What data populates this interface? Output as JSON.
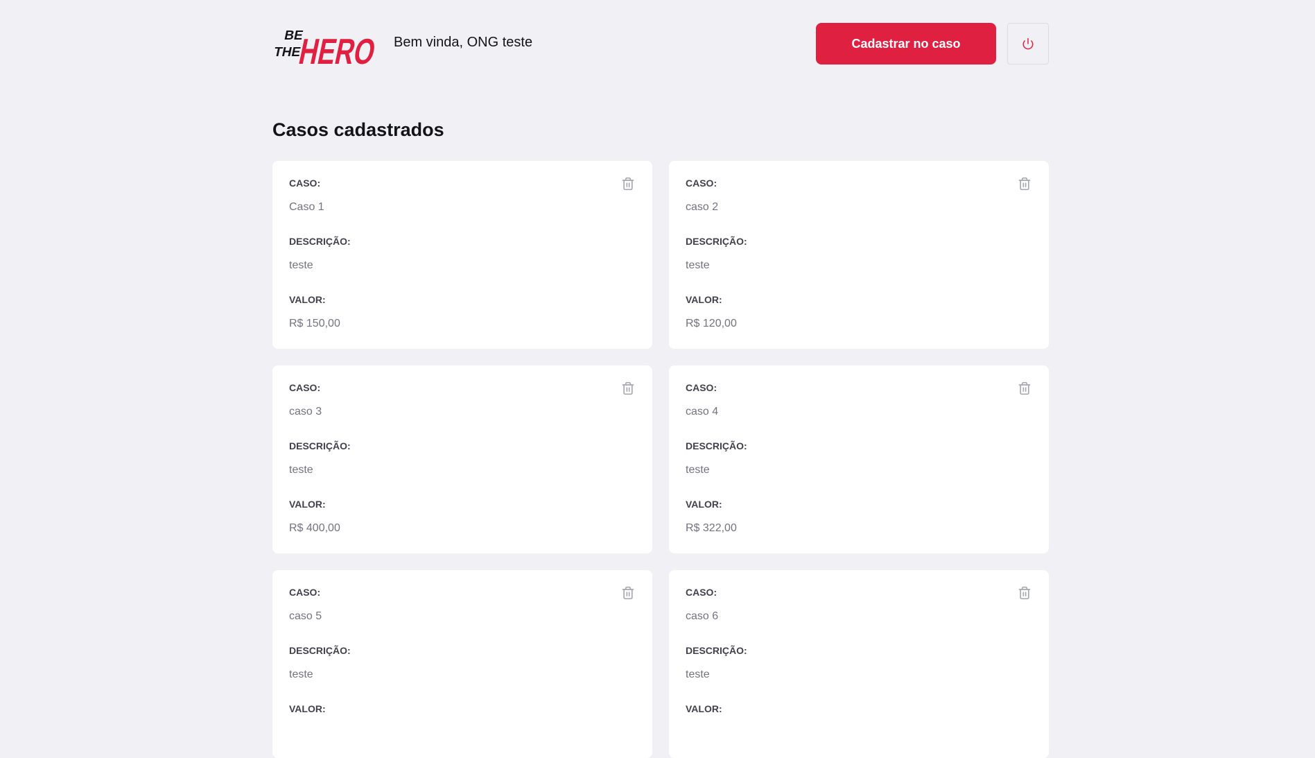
{
  "header": {
    "logo": {
      "top": "BE",
      "middle": "THE",
      "main": "HERO"
    },
    "greeting": "Bem vinda, ONG teste",
    "register_button": "Cadastrar no caso",
    "power_icon": "power-icon"
  },
  "main": {
    "title": "Casos cadastrados",
    "field_labels": {
      "case": "CASO:",
      "description": "DESCRIÇÃO:",
      "value": "VALOR:"
    },
    "cases": [
      {
        "title": "Caso 1",
        "description": "teste",
        "value": "R$ 150,00"
      },
      {
        "title": "caso 2",
        "description": "teste",
        "value": "R$ 120,00"
      },
      {
        "title": "caso 3",
        "description": "teste",
        "value": "R$ 400,00"
      },
      {
        "title": "caso 4",
        "description": "teste",
        "value": "R$ 322,00"
      },
      {
        "title": "caso 5",
        "description": "teste",
        "value": ""
      },
      {
        "title": "caso 6",
        "description": "teste",
        "value": ""
      }
    ]
  },
  "colors": {
    "accent": "#e02041",
    "background": "#f0f0f5",
    "card": "#ffffff",
    "label": "#41414d",
    "muted": "#737380",
    "icon": "#a8a8b3"
  }
}
